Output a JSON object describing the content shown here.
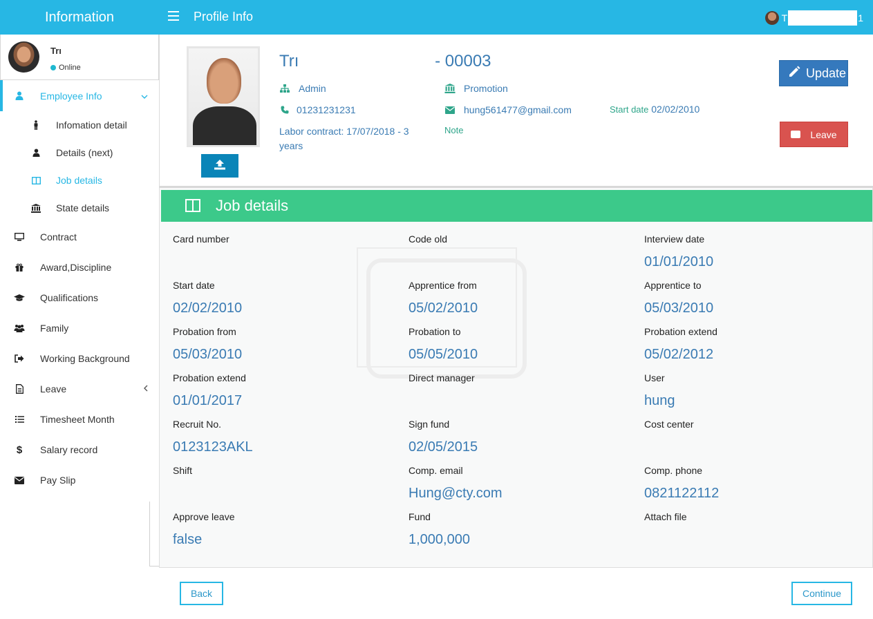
{
  "header": {
    "brand": "Information",
    "page_title": "Profile Info",
    "user_initial": "T",
    "user_suffix": "1",
    "menu_icon": "hamburger-icon"
  },
  "user_panel": {
    "name": "Trı",
    "status": "Online",
    "status_color": "#1fb8d0"
  },
  "sidebar": {
    "employee_info": {
      "label": "Employee Info",
      "icon": "user-icon",
      "chevron": "⌄"
    },
    "sub_items": [
      {
        "label": "Infomation detail",
        "icon": "person-icon"
      },
      {
        "label": "Details (next)",
        "icon": "user-icon"
      },
      {
        "label": "Job details",
        "icon": "columns-icon"
      },
      {
        "label": "State details",
        "icon": "bank-icon"
      }
    ],
    "items": [
      {
        "label": "Contract",
        "icon": "monitor-icon"
      },
      {
        "label": "Award,Discipline",
        "icon": "gift-icon"
      },
      {
        "label": "Qualifications",
        "icon": "graduation-cap-icon"
      },
      {
        "label": "Family",
        "icon": "users-icon"
      },
      {
        "label": "Working Background",
        "icon": "sign-out-icon"
      },
      {
        "label": "Leave",
        "icon": "document-icon",
        "chevron": "‹"
      },
      {
        "label": "Timesheet Month",
        "icon": "list-icon"
      },
      {
        "label": "Salary record",
        "icon": "dollar-icon"
      },
      {
        "label": "Pay Slip",
        "icon": "envelope-icon"
      }
    ]
  },
  "profile": {
    "name_start": "Trı",
    "name_end": "- 00003",
    "department": "Admin",
    "promotion": "Promotion",
    "phone": "01231231231",
    "email": "hung561477@gmail.com",
    "start_date_label": "Start date",
    "start_date": "02/02/2010",
    "labor_contract": "Labor contract: 17/07/2018 - 3 years",
    "note": "Note",
    "update_label": "Update",
    "leave_label": "Leave"
  },
  "job_details": {
    "title": "Job details",
    "fields": [
      {
        "label": "Card number",
        "value": ""
      },
      {
        "label": "Code old",
        "value": ""
      },
      {
        "label": "Interview date",
        "value": "01/01/2010"
      },
      {
        "label": "Start date",
        "value": "02/02/2010"
      },
      {
        "label": "Apprentice from",
        "value": "05/02/2010"
      },
      {
        "label": "Apprentice to",
        "value": "05/03/2010"
      },
      {
        "label": "Probation from",
        "value": "05/03/2010"
      },
      {
        "label": "Probation to",
        "value": "05/05/2010"
      },
      {
        "label": "Probation extend",
        "value": "05/02/2012"
      },
      {
        "label": "Probation extend",
        "value": "01/01/2017"
      },
      {
        "label": "Direct manager",
        "value": ""
      },
      {
        "label": "User",
        "value": "hung"
      },
      {
        "label": "Recruit No.",
        "value": "0123123AKL"
      },
      {
        "label": "Sign fund",
        "value": "02/05/2015"
      },
      {
        "label": "Cost center",
        "value": ""
      },
      {
        "label": "Shift",
        "value": ""
      },
      {
        "label": "Comp. email",
        "value": "Hung@cty.com"
      },
      {
        "label": "Comp. phone",
        "value": "0821122112"
      },
      {
        "label": "Approve leave",
        "value": "false"
      },
      {
        "label": "Fund",
        "value": "1,000,000"
      },
      {
        "label": "Attach file",
        "value": ""
      }
    ]
  },
  "footer": {
    "back_label": "Back",
    "continue_label": "Continue"
  },
  "colors": {
    "topbar": "#27b7e4",
    "accent": "#27b7e4",
    "job_header": "#3cc98a",
    "value_text": "#3a7bb3",
    "update_button": "#3579bd",
    "leave_button": "#d9534f"
  }
}
